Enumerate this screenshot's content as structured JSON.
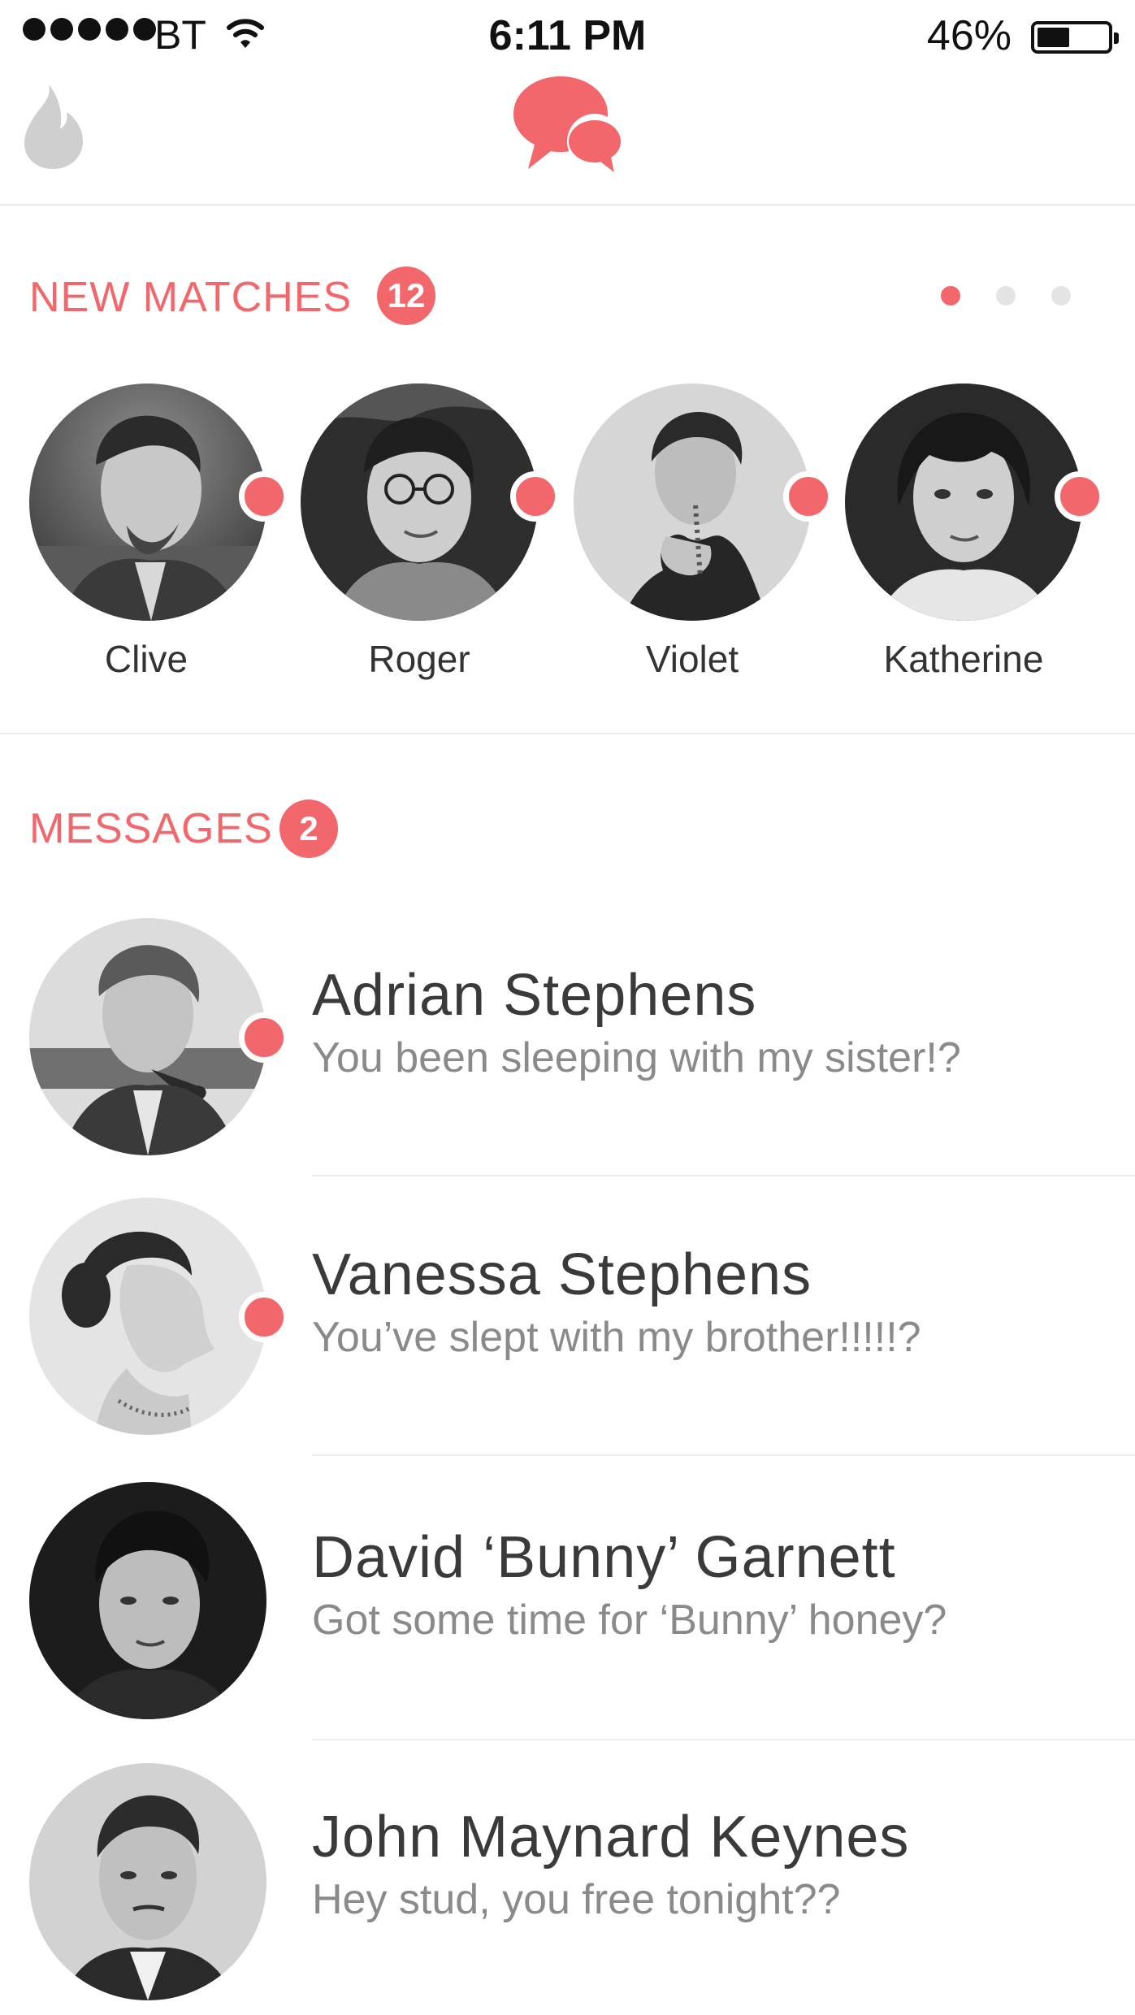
{
  "status_bar": {
    "carrier": "BT",
    "time": "6:11 PM",
    "battery_percent": "46%",
    "battery_level": 0.46,
    "signal_bars": 5
  },
  "nav": {
    "left_icon": "flame-icon",
    "center_icon": "chat-bubbles-icon"
  },
  "colors": {
    "accent": "#f2676b",
    "divider": "#ececec",
    "name_text": "#3a3a3a",
    "preview_text": "#8a8a8a"
  },
  "new_matches": {
    "label": "NEW MATCHES",
    "count": "12",
    "pages": 3,
    "current_page": 1,
    "items": [
      {
        "name": "Clive",
        "new": true
      },
      {
        "name": "Roger",
        "new": true
      },
      {
        "name": "Violet",
        "new": true
      },
      {
        "name": "Katherine",
        "new": true
      }
    ]
  },
  "messages": {
    "label": "MESSAGES",
    "count": "2",
    "items": [
      {
        "name": "Adrian Stephens",
        "preview": "You been sleeping with my sister!?",
        "unread": true
      },
      {
        "name": "Vanessa Stephens",
        "preview": "You’ve slept with my brother!!!!!?",
        "unread": true
      },
      {
        "name": "David ‘Bunny’ Garnett",
        "preview": "Got some time for ‘Bunny’ honey?",
        "unread": false
      },
      {
        "name": "John Maynard Keynes",
        "preview": "Hey stud, you free tonight??",
        "unread": false
      }
    ]
  }
}
